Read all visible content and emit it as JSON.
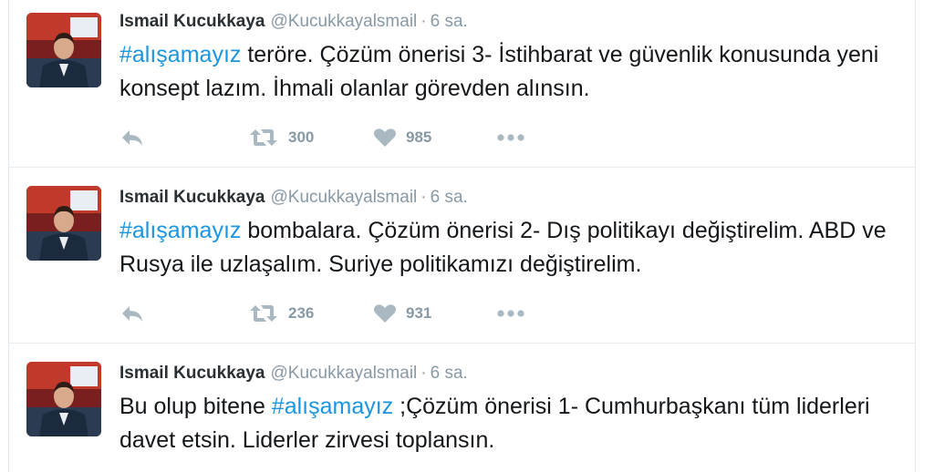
{
  "tweets": [
    {
      "name": "Ismail Kucukkaya",
      "handle": "@Kucukkayalsmail",
      "separator": "·",
      "time": "6 sa.",
      "text_before": "",
      "hashtag": "#alışamayız",
      "text_after": " teröre. Çözüm önerisi 3- İstihbarat ve güvenlik konusunda yeni konsept lazım. İhmali olanlar görevden alınsın.",
      "retweets": "300",
      "likes": "985"
    },
    {
      "name": "Ismail Kucukkaya",
      "handle": "@Kucukkayalsmail",
      "separator": "·",
      "time": "6 sa.",
      "text_before": "",
      "hashtag": "#alışamayız",
      "text_after": " bombalara. Çözüm önerisi 2- Dış politikayı değiştirelim. ABD ve Rusya ile uzlaşalım. Suriye politikamızı değiştirelim.",
      "retweets": "236",
      "likes": "931"
    },
    {
      "name": "Ismail Kucukkaya",
      "handle": "@Kucukkayalsmail",
      "separator": "·",
      "time": "6 sa.",
      "text_before": "Bu olup bitene ",
      "hashtag": "#alışamayız",
      "text_after": " ;Çözüm önerisi 1- Cumhurbaşkanı tüm liderleri davet etsin. Liderler zirvesi toplansın.",
      "retweets": "",
      "likes": ""
    }
  ],
  "icons": {
    "reply": "reply-icon",
    "retweet": "retweet-icon",
    "like": "heart-icon",
    "more": "more-dots-icon"
  },
  "colors": {
    "hashtag": "#1b95e0",
    "icon": "#aab8c2",
    "muted": "#8899a6"
  }
}
